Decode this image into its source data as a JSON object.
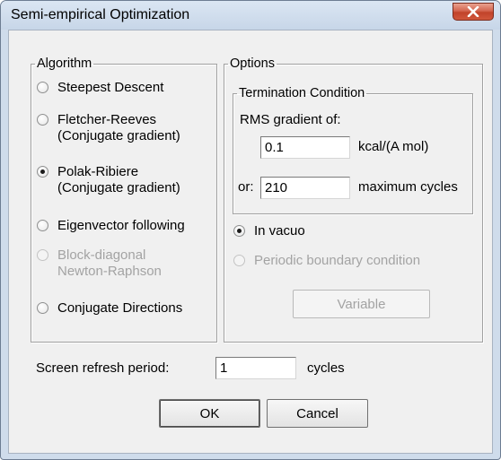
{
  "window": {
    "title": "Semi-empirical Optimization"
  },
  "algorithm": {
    "legend": "Algorithm",
    "options": [
      {
        "line1": "Steepest Descent",
        "line2": "",
        "checked": false,
        "enabled": true
      },
      {
        "line1": "Fletcher-Reeves",
        "line2": "(Conjugate gradient)",
        "checked": false,
        "enabled": true
      },
      {
        "line1": "Polak-Ribiere",
        "line2": "(Conjugate gradient)",
        "checked": true,
        "enabled": true
      },
      {
        "line1": "Eigenvector following",
        "line2": "",
        "checked": false,
        "enabled": true
      },
      {
        "line1": "Block-diagonal",
        "line2": "Newton-Raphson",
        "checked": false,
        "enabled": false
      },
      {
        "line1": "Conjugate Directions",
        "line2": "",
        "checked": false,
        "enabled": true
      }
    ]
  },
  "options": {
    "legend": "Options",
    "termination": {
      "legend": "Termination Condition",
      "rms_label": "RMS gradient of:",
      "rms_value": "0.1",
      "rms_unit": "kcal/(A mol)",
      "or_label": "or:",
      "cycles_value": "210",
      "cycles_unit": "maximum cycles"
    },
    "in_vacuo": {
      "label": "In vacuo",
      "checked": true
    },
    "periodic": {
      "label": "Periodic boundary condition",
      "checked": false,
      "enabled": false
    },
    "variable_button": "Variable"
  },
  "refresh": {
    "label": "Screen refresh period:",
    "value": "1",
    "unit": "cycles"
  },
  "buttons": {
    "ok": "OK",
    "cancel": "Cancel"
  },
  "colors": {
    "close_button": "#c9503a",
    "dialog_bg": "#f0f0f0",
    "frame": "#cfdceb"
  }
}
